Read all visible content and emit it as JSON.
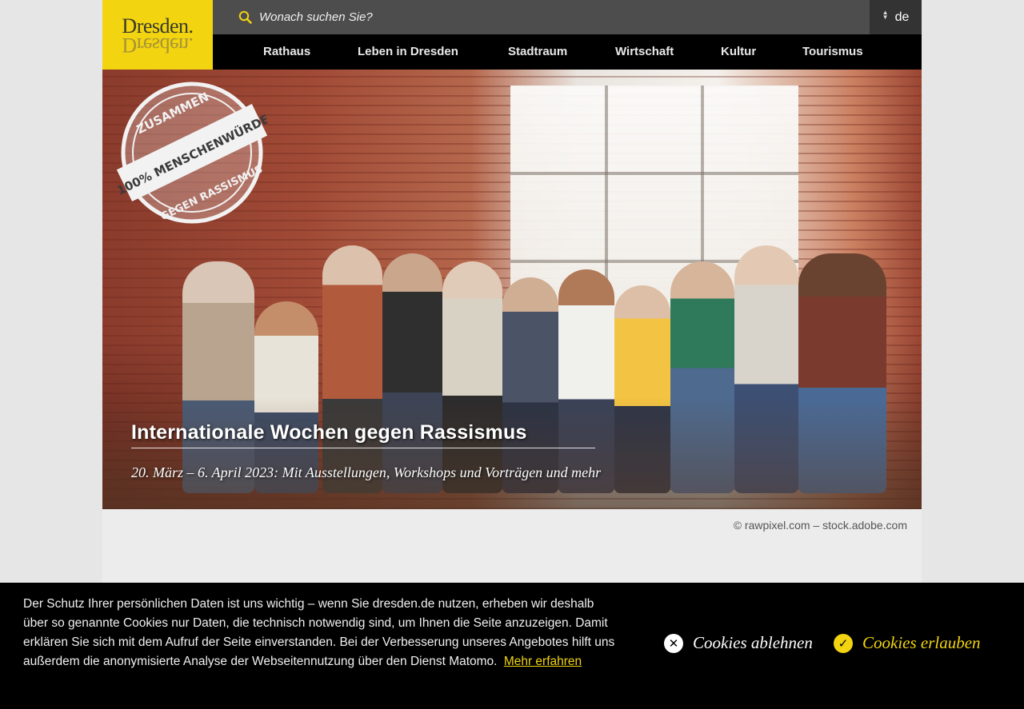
{
  "logo": {
    "text": "Dresden."
  },
  "search": {
    "placeholder": "Wonach suchen Sie?"
  },
  "language": {
    "current": "de"
  },
  "nav": {
    "items": [
      {
        "label": "Rathaus"
      },
      {
        "label": "Leben in Dresden"
      },
      {
        "label": "Stadtraum"
      },
      {
        "label": "Wirtschaft"
      },
      {
        "label": "Kultur"
      },
      {
        "label": "Tourismus"
      }
    ]
  },
  "hero": {
    "title": "Internationale Wochen gegen Rassismus",
    "subtitle": "20. März – 6. April 2023: Mit Ausstellungen, Workshops und Vorträgen und mehr",
    "stamp": {
      "top": "ZUSAMMEN",
      "middle": "100% MENSCHENWÜRDE",
      "bottom": "GEGEN RASSISMUS"
    },
    "credit": "© rawpixel.com – stock.adobe.com"
  },
  "cookie_banner": {
    "text": "Der Schutz Ihrer persönlichen Daten ist uns wichtig – wenn Sie dresden.de nutzen, erheben wir deshalb über so genannte Cookies nur Daten, die technisch notwendig sind, um Ihnen die Seite anzuzeigen. Damit erklären Sie sich mit dem Aufruf der Seite einverstanden. Bei der Verbesserung unseres Angebotes hilft uns außerdem die anonymisierte Analyse der Webseitennutzung über den Dienst Matomo.",
    "more_link": "Mehr erfahren",
    "decline_label": "Cookies ablehnen",
    "allow_label": "Cookies erlauben"
  },
  "colors": {
    "brand_yellow": "#f2d411",
    "nav_bg": "#000000",
    "search_bg": "#4d4d4d"
  },
  "icons": [
    "search-icon",
    "language-arrows-icon",
    "close-circle-icon",
    "check-circle-icon"
  ]
}
